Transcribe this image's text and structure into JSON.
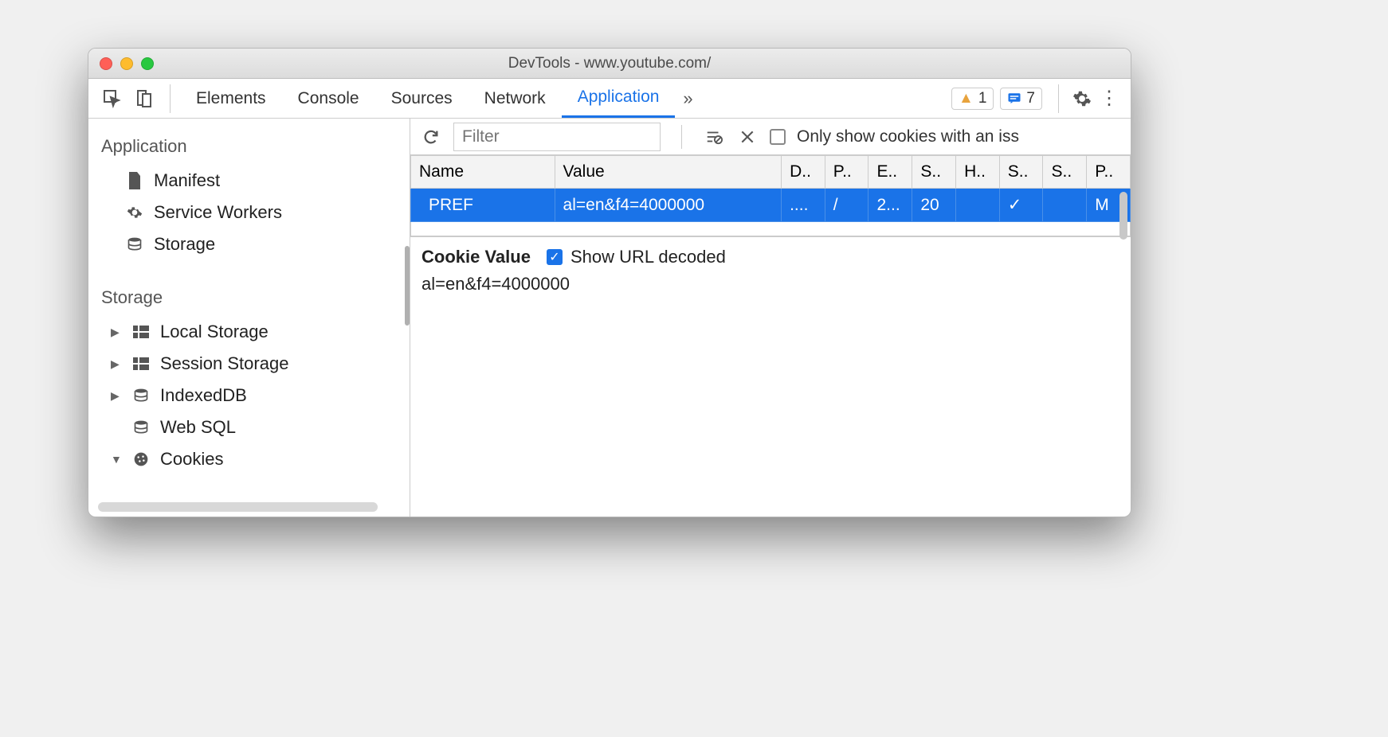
{
  "window": {
    "title": "DevTools - www.youtube.com/"
  },
  "tabs": {
    "items": [
      "Elements",
      "Console",
      "Sources",
      "Network",
      "Application"
    ],
    "active": "Application",
    "overflow": "»",
    "warnings": "1",
    "messages": "7"
  },
  "sidebar": {
    "section1": {
      "title": "Application",
      "items": [
        "Manifest",
        "Service Workers",
        "Storage"
      ]
    },
    "section2": {
      "title": "Storage",
      "items": [
        "Local Storage",
        "Session Storage",
        "IndexedDB",
        "Web SQL",
        "Cookies"
      ]
    }
  },
  "toolbar": {
    "filter_placeholder": "Filter",
    "only_issues_label": "Only show cookies with an iss"
  },
  "table": {
    "headers": [
      "Name",
      "Value",
      "D..",
      "P..",
      "E..",
      "S..",
      "H..",
      "S..",
      "S..",
      "P.."
    ],
    "rows": [
      {
        "cells": [
          "PREF",
          "al=en&f4=4000000",
          "....",
          "/",
          "2...",
          "20",
          "",
          "✓",
          "",
          "M"
        ],
        "selected": true
      }
    ]
  },
  "detail": {
    "title": "Cookie Value",
    "decoded_label": "Show URL decoded",
    "decoded_checked": true,
    "value": "al=en&f4=4000000"
  }
}
